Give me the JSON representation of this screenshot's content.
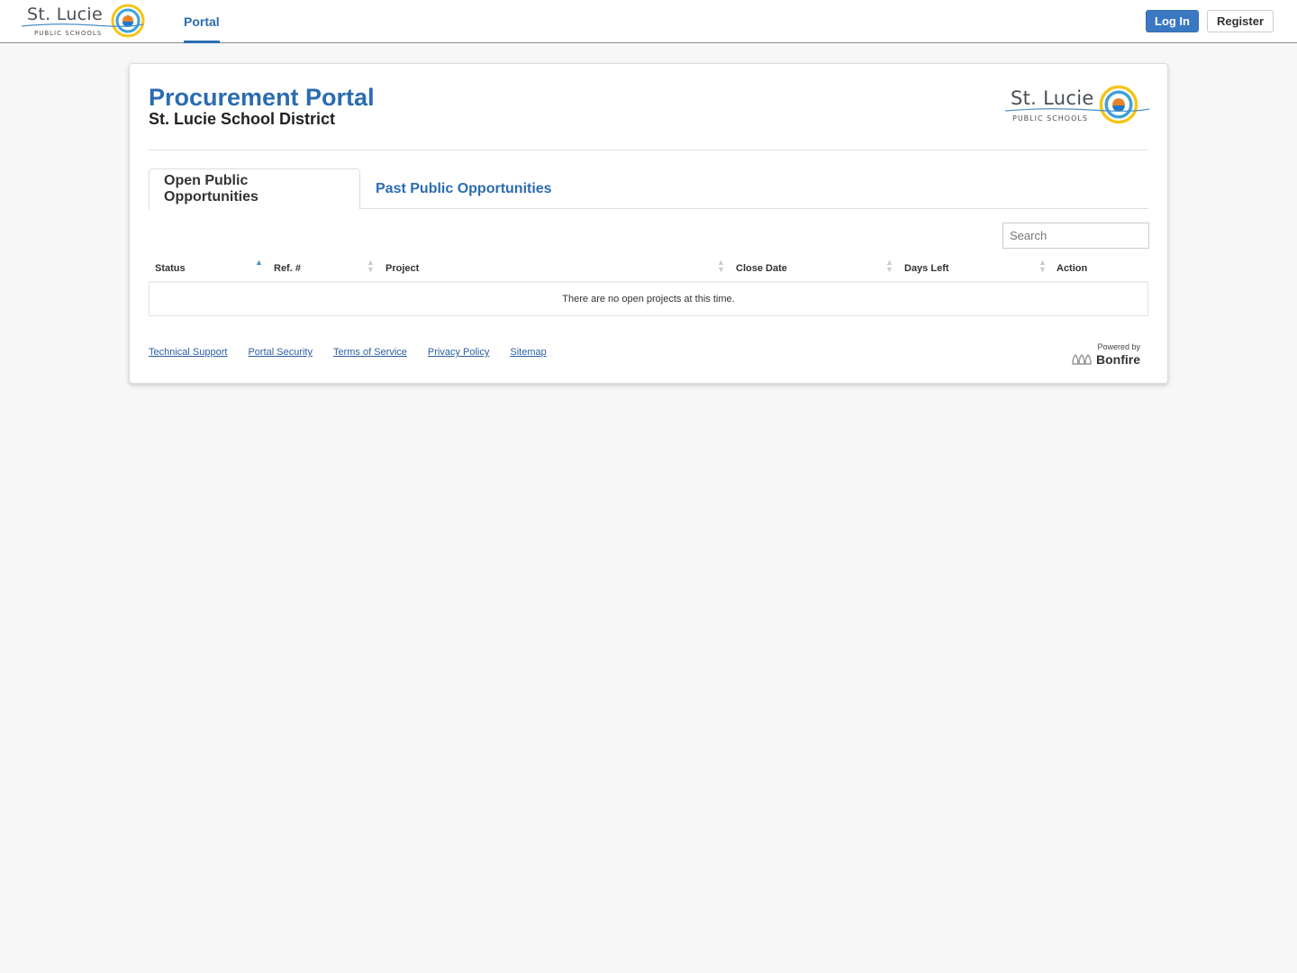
{
  "header": {
    "logo": {
      "name": "St. Lucie",
      "sub": "PUBLIC SCHOOLS"
    },
    "nav": [
      {
        "label": "Portal",
        "active": true
      }
    ],
    "login_label": "Log In",
    "register_label": "Register"
  },
  "card": {
    "title": "Procurement Portal",
    "subtitle": "St. Lucie School District",
    "logo": {
      "name": "St. Lucie",
      "sub": "PUBLIC SCHOOLS"
    }
  },
  "tabs": [
    {
      "label": "Open Public Opportunities",
      "active": true
    },
    {
      "label": "Past Public Opportunities",
      "active": false
    }
  ],
  "search": {
    "placeholder": "Search",
    "value": ""
  },
  "table": {
    "columns": [
      {
        "label": "Status",
        "sort": "asc"
      },
      {
        "label": "Ref. #",
        "sort": "none"
      },
      {
        "label": "Project",
        "sort": "none"
      },
      {
        "label": "Close Date",
        "sort": "none"
      },
      {
        "label": "Days Left",
        "sort": "none"
      },
      {
        "label": "Action",
        "sort": "none"
      }
    ],
    "empty_message": "There are no open projects at this time."
  },
  "footer": {
    "links": [
      "Technical Support",
      "Portal Security",
      "Terms of Service",
      "Privacy Policy",
      "Sitemap"
    ],
    "powered_by": "Powered by",
    "brand": "Bonfire"
  },
  "colors": {
    "accent": "#2b6cb0",
    "login_button": "#3a78c2",
    "background": "#f7f7f7"
  }
}
